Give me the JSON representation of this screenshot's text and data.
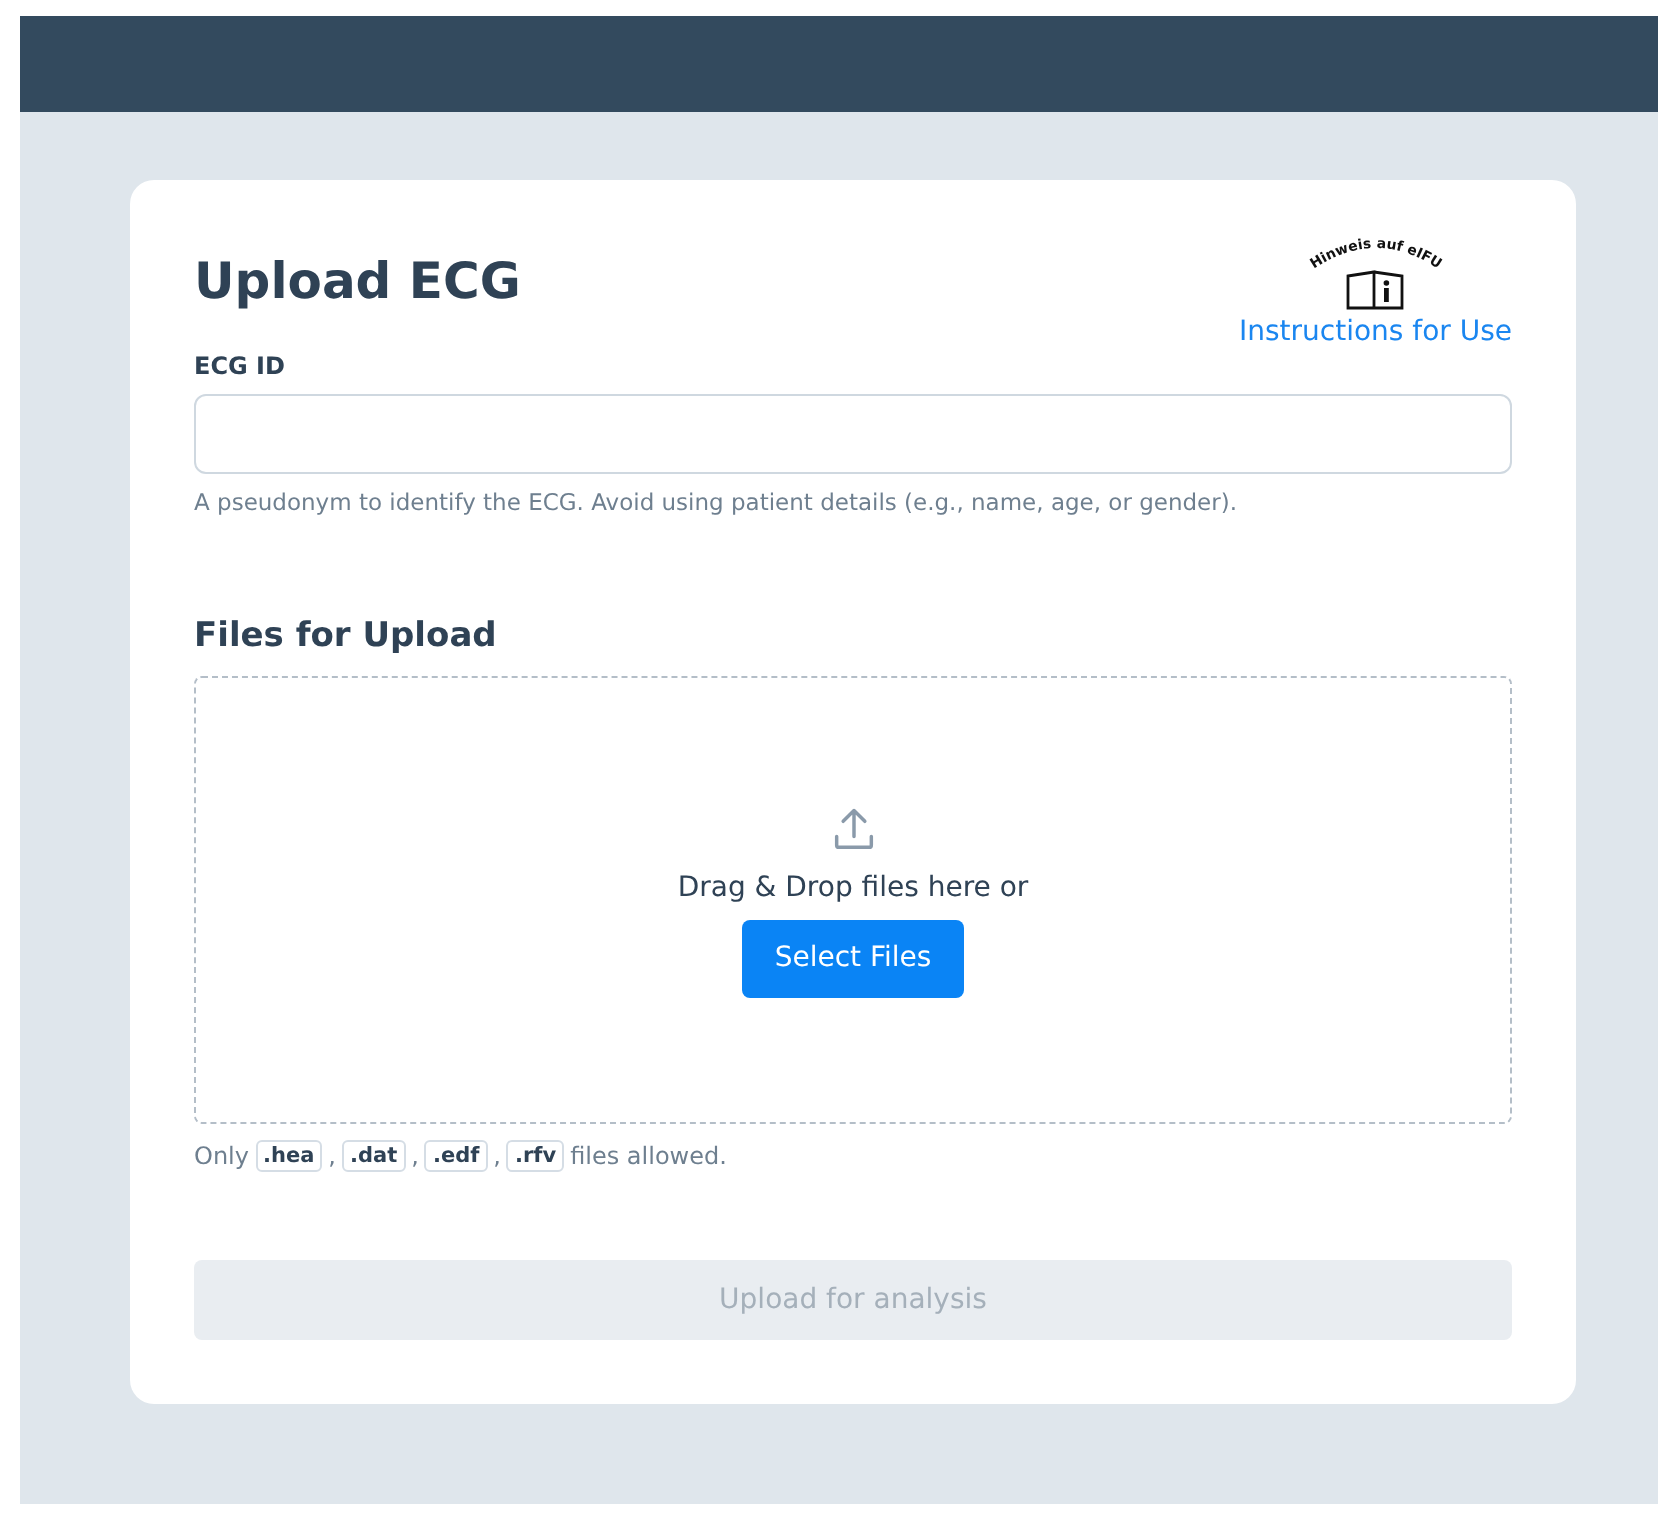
{
  "title": "Upload ECG",
  "ifu": {
    "icon_caption": "Hinweis auf eIFU",
    "link": "Instructions for Use"
  },
  "ecg_id": {
    "label": "ECG ID",
    "help": "A pseudonym to identify the ECG. Avoid using patient details (e.g., name, age, or gender)."
  },
  "files": {
    "heading": "Files for Upload",
    "drop_text": "Drag & Drop files here or",
    "select_button": "Select Files"
  },
  "allowed": {
    "prefix": "Only",
    "extensions": [
      {
        "ext": ".hea",
        "separator": ","
      },
      {
        "ext": ".dat",
        "separator": ","
      },
      {
        "ext": ".edf",
        "separator": ","
      },
      {
        "ext": ".rfv"
      }
    ],
    "suffix": "files allowed."
  },
  "submit": {
    "label": "Upload for analysis",
    "disabled": true
  }
}
